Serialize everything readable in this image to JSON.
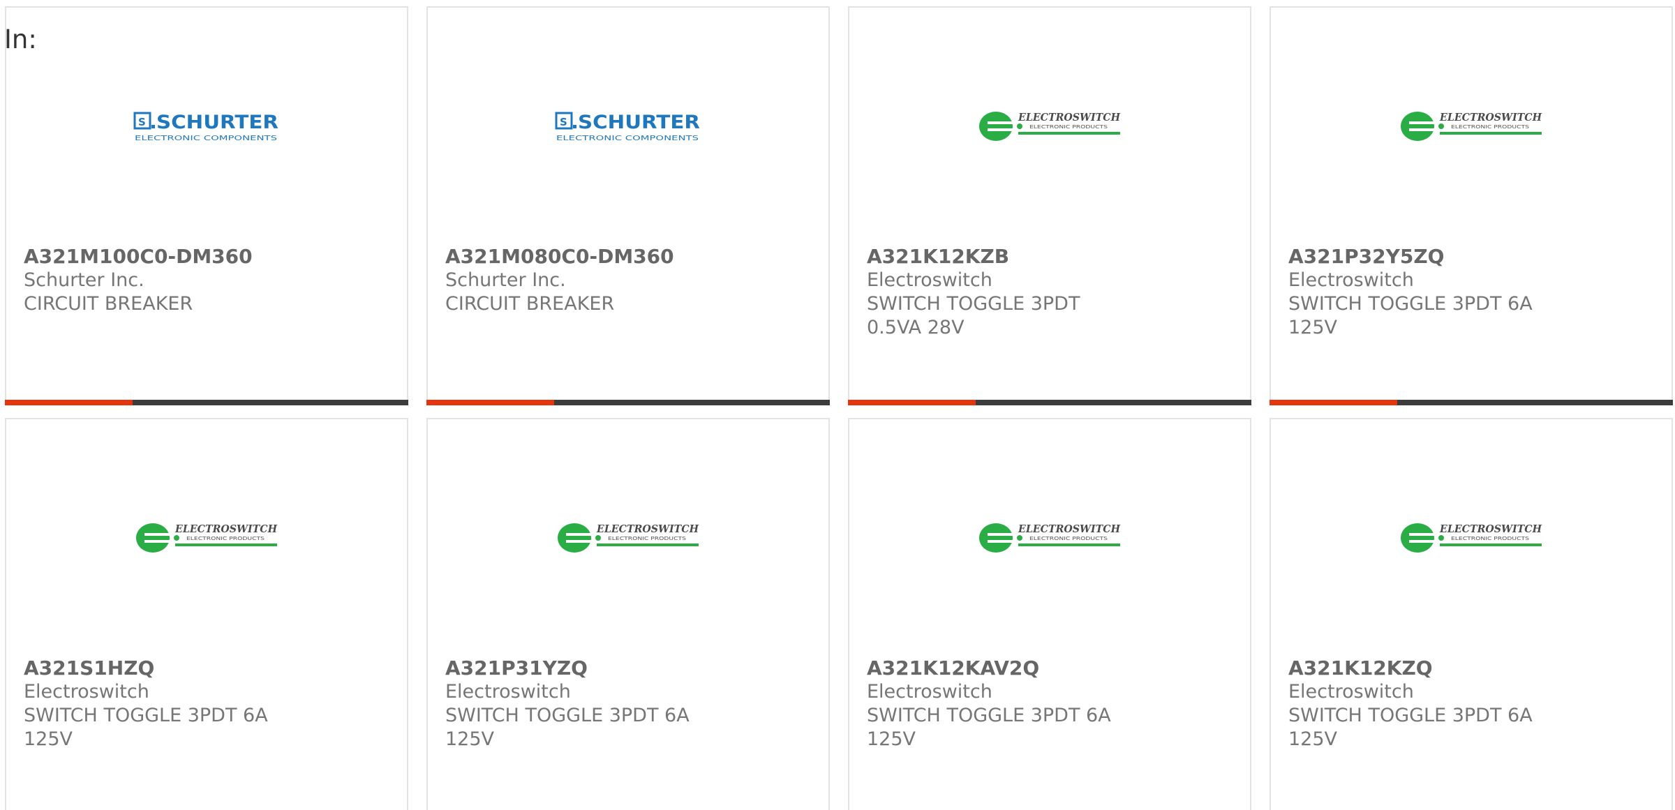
{
  "page": {
    "in_label": "In:"
  },
  "colors": {
    "bar_accent": "#e4350f",
    "bar_dark": "#3c3c3c",
    "schurter_blue": "#1f78be",
    "electroswitch_green": "#2bad45"
  },
  "products": [
    {
      "logo": "schurter-logo",
      "logo_text": "SCHURTER",
      "logo_sub": "ELECTRONIC COMPONENTS",
      "part": "A321M100C0-DM360",
      "manufacturer": "Schurter Inc.",
      "description": "CIRCUIT BREAKER"
    },
    {
      "logo": "schurter-logo",
      "logo_text": "SCHURTER",
      "logo_sub": "ELECTRONIC COMPONENTS",
      "part": "A321M080C0-DM360",
      "manufacturer": "Schurter Inc.",
      "description": "CIRCUIT BREAKER"
    },
    {
      "logo": "electroswitch-logo",
      "logo_text": "ELECTROSWITCH",
      "logo_sub": "ELECTRONIC PRODUCTS",
      "part": "A321K12KZB",
      "manufacturer": "Electroswitch",
      "description": "SWITCH TOGGLE 3PDT 0.5VA 28V"
    },
    {
      "logo": "electroswitch-logo",
      "logo_text": "ELECTROSWITCH",
      "logo_sub": "ELECTRONIC PRODUCTS",
      "part": "A321P32Y5ZQ",
      "manufacturer": "Electroswitch",
      "description": "SWITCH TOGGLE 3PDT 6A 125V"
    },
    {
      "logo": "electroswitch-logo",
      "logo_text": "ELECTROSWITCH",
      "logo_sub": "ELECTRONIC PRODUCTS",
      "part": "A321S1HZQ",
      "manufacturer": "Electroswitch",
      "description": "SWITCH TOGGLE 3PDT 6A 125V"
    },
    {
      "logo": "electroswitch-logo",
      "logo_text": "ELECTROSWITCH",
      "logo_sub": "ELECTRONIC PRODUCTS",
      "part": "A321P31YZQ",
      "manufacturer": "Electroswitch",
      "description": "SWITCH TOGGLE 3PDT 6A 125V"
    },
    {
      "logo": "electroswitch-logo",
      "logo_text": "ELECTROSWITCH",
      "logo_sub": "ELECTRONIC PRODUCTS",
      "part": "A321K12KAV2Q",
      "manufacturer": "Electroswitch",
      "description": "SWITCH TOGGLE 3PDT 6A 125V"
    },
    {
      "logo": "electroswitch-logo",
      "logo_text": "ELECTROSWITCH",
      "logo_sub": "ELECTRONIC PRODUCTS",
      "part": "A321K12KZQ",
      "manufacturer": "Electroswitch",
      "description": "SWITCH TOGGLE 3PDT 6A 125V"
    }
  ]
}
